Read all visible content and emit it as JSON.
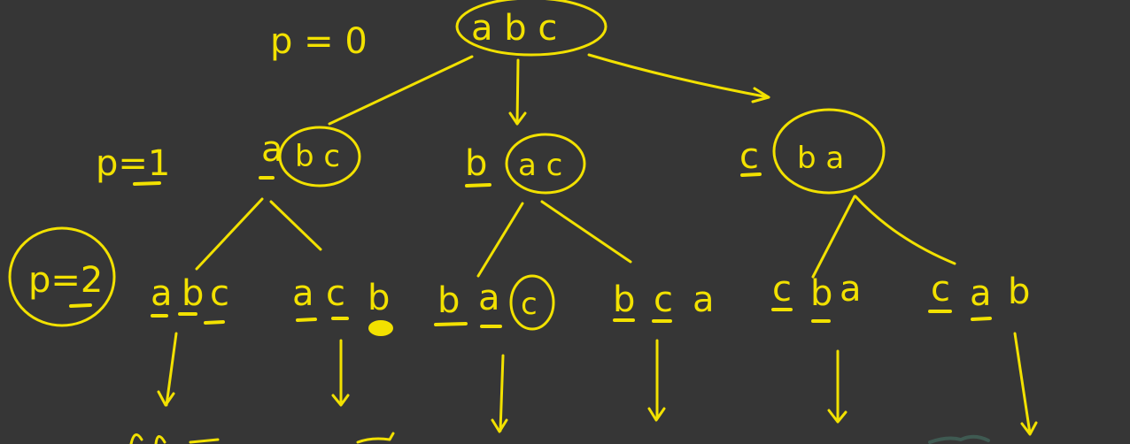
{
  "levels": {
    "p0": "p = 0",
    "p1": "p=1",
    "p2": "p=2"
  },
  "nodes": {
    "root": "a b c",
    "l1_left": {
      "fixed": "a",
      "rest": "b c"
    },
    "l1_mid": {
      "fixed": "b",
      "rest": "a c"
    },
    "l1_right": {
      "fixed": "c",
      "rest": "b a"
    },
    "leaves": [
      {
        "a": "a",
        "b": "b",
        "c": "c"
      },
      {
        "a": "a",
        "b": "c",
        "c": "b"
      },
      {
        "a": "b",
        "b": "a",
        "c": "c"
      },
      {
        "a": "b",
        "b": "c",
        "c": "a"
      },
      {
        "a": "c",
        "b": "b",
        "c": "a"
      },
      {
        "a": "c",
        "b": "a",
        "c": "b"
      }
    ]
  },
  "colors": {
    "background": "#363636",
    "ink": "#f2e100"
  }
}
